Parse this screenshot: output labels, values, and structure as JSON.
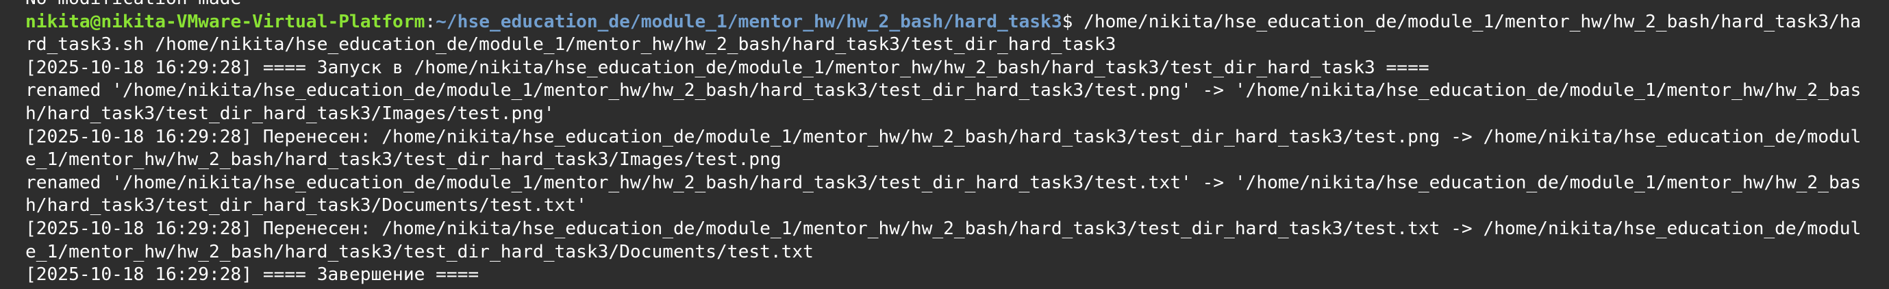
{
  "terminal": {
    "lines": [
      {
        "kind": "output",
        "text": "No modification made"
      },
      {
        "kind": "prompt",
        "user": "nikita@nikita-VMware-Virtual-Platform",
        "sep": ":",
        "path": "~/hse_education_de/module_1/mentor_hw/hw_2_bash/hard_task3",
        "sym": "$ ",
        "cmd": "/home/nikita/hse_education_de/module_1/mentor_hw/hw_2_bash/hard_task3/ha"
      },
      {
        "kind": "output",
        "text": "rd_task3.sh /home/nikita/hse_education_de/module_1/mentor_hw/hw_2_bash/hard_task3/test_dir_hard_task3"
      },
      {
        "kind": "output",
        "text": "[2025-10-18 16:29:28] ==== Запуск в /home/nikita/hse_education_de/module_1/mentor_hw/hw_2_bash/hard_task3/test_dir_hard_task3 ===="
      },
      {
        "kind": "output",
        "text": "renamed '/home/nikita/hse_education_de/module_1/mentor_hw/hw_2_bash/hard_task3/test_dir_hard_task3/test.png' -> '/home/nikita/hse_education_de/module_1/mentor_hw/hw_2_bas"
      },
      {
        "kind": "output",
        "text": "h/hard_task3/test_dir_hard_task3/Images/test.png'"
      },
      {
        "kind": "output",
        "text": "[2025-10-18 16:29:28] Перенесен: /home/nikita/hse_education_de/module_1/mentor_hw/hw_2_bash/hard_task3/test_dir_hard_task3/test.png -> /home/nikita/hse_education_de/modul"
      },
      {
        "kind": "output",
        "text": "e_1/mentor_hw/hw_2_bash/hard_task3/test_dir_hard_task3/Images/test.png"
      },
      {
        "kind": "output",
        "text": "renamed '/home/nikita/hse_education_de/module_1/mentor_hw/hw_2_bash/hard_task3/test_dir_hard_task3/test.txt' -> '/home/nikita/hse_education_de/module_1/mentor_hw/hw_2_bas"
      },
      {
        "kind": "output",
        "text": "h/hard_task3/test_dir_hard_task3/Documents/test.txt'"
      },
      {
        "kind": "output",
        "text": "[2025-10-18 16:29:28] Перенесен: /home/nikita/hse_education_de/module_1/mentor_hw/hw_2_bash/hard_task3/test_dir_hard_task3/test.txt -> /home/nikita/hse_education_de/modul"
      },
      {
        "kind": "output",
        "text": "e_1/mentor_hw/hw_2_bash/hard_task3/test_dir_hard_task3/Documents/test.txt"
      },
      {
        "kind": "output",
        "text": "[2025-10-18 16:29:28] ==== Завершение ===="
      }
    ]
  }
}
